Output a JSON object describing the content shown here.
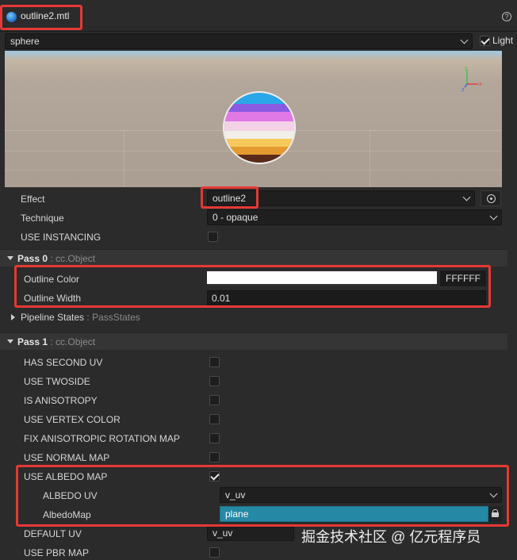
{
  "asset": {
    "name": "outline2.mtl",
    "icon": "material-sphere-icon"
  },
  "help_icon": "?",
  "preview": {
    "mesh": "sphere",
    "light_label": "Light",
    "light_checked": true,
    "axes": {
      "y": "y",
      "x": "x",
      "z": "z"
    }
  },
  "inspector": {
    "effect_label": "Effect",
    "effect_value": "outline2",
    "technique_label": "Technique",
    "technique_value": "0 - opaque",
    "use_instancing_label": "USE INSTANCING",
    "use_instancing_checked": false,
    "pass0": {
      "name": "Pass 0",
      "type": ": cc.Object",
      "outline_color_label": "Outline Color",
      "outline_color_hex": "FFFFFF",
      "outline_width_label": "Outline Width",
      "outline_width_value": "0.01",
      "pipeline_states_label": "Pipeline States",
      "pipeline_states_type": ": PassStates"
    },
    "pass1": {
      "name": "Pass 1",
      "type": ": cc.Object",
      "flags": [
        {
          "label": "HAS SECOND UV",
          "checked": false
        },
        {
          "label": "USE TWOSIDE",
          "checked": false
        },
        {
          "label": "IS ANISOTROPY",
          "checked": false
        },
        {
          "label": "USE VERTEX COLOR",
          "checked": false
        },
        {
          "label": "FIX ANISOTROPIC ROTATION MAP",
          "checked": false
        },
        {
          "label": "USE NORMAL MAP",
          "checked": false
        },
        {
          "label": "USE ALBEDO MAP",
          "checked": true
        }
      ],
      "albedo_uv_label": "ALBEDO UV",
      "albedo_uv_value": "v_uv",
      "albedo_map_label": "AlbedoMap",
      "albedo_map_value": "plane",
      "default_uv_label": "DEFAULT UV",
      "default_uv_value": "v_uv",
      "use_pbr_map_label": "USE PBR MAP",
      "use_pbr_map_checked": false
    }
  },
  "watermark": "掘金技术社区 @ 亿元程序员",
  "colors": {
    "highlight": "#e53935",
    "asset_field": "#2589a5",
    "panel_bg": "#2b2b2b"
  }
}
